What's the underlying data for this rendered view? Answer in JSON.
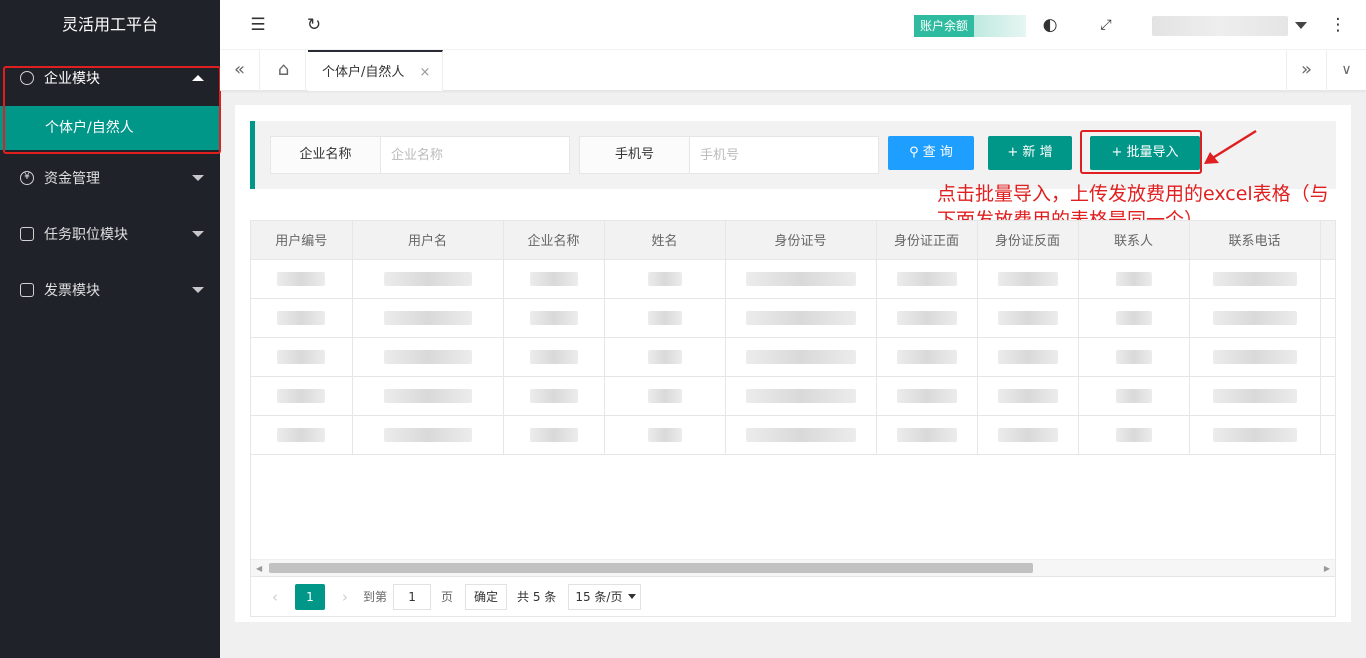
{
  "sidebar": {
    "logo": "灵活用工平台",
    "items": [
      {
        "label": "企业模块",
        "icon": "user-settings-icon",
        "open": true
      },
      {
        "label": "资金管理",
        "icon": "yen-icon"
      },
      {
        "label": "任务职位模块",
        "icon": "task-icon"
      },
      {
        "label": "发票模块",
        "icon": "invoice-icon"
      }
    ],
    "sub_items": [
      {
        "label": "个体户/自然人",
        "active": true
      }
    ]
  },
  "header": {
    "balance_label": "账户余额"
  },
  "tabs": {
    "active_tab": "个体户/自然人",
    "close": "×"
  },
  "search": {
    "company_label": "企业名称",
    "company_placeholder": "企业名称",
    "phone_label": "手机号",
    "phone_placeholder": "手机号",
    "query_button": "查 询",
    "add_button": "+ 新 增",
    "import_button": "+ 批量导入"
  },
  "annotation": "点击批量导入，上传发放费用的excel表格（与下面发放费用的表格是同一个）",
  "table": {
    "columns": [
      "用户编号",
      "用户名",
      "企业名称",
      "姓名",
      "身份证号",
      "身份证正面",
      "身份证反面",
      "联系人",
      "联系电话"
    ]
  },
  "pager": {
    "current_page": "1",
    "goto_label": "到第",
    "goto_value": "1",
    "page_unit": "页",
    "confirm": "确定",
    "total": "共 5 条",
    "page_size": "15 条/页"
  },
  "colors": {
    "sidebar_bg": "#20222a",
    "accent": "#009688",
    "query_blue": "#1e9fff",
    "annotation_red": "#e02020"
  }
}
